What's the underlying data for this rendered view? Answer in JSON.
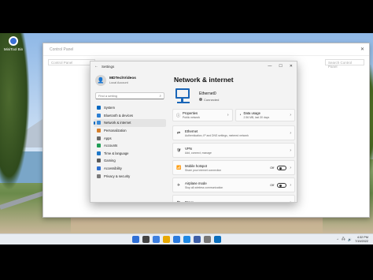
{
  "desktop": {
    "icon_label": "MiniTool Bin"
  },
  "control_panel": {
    "title": "Control Panel",
    "address": "Control Panel",
    "search": "Search Control Panel",
    "close": "✕"
  },
  "settings": {
    "window_title": "Settings",
    "back": "←",
    "controls": {
      "minimize": "—",
      "maximize": "☐",
      "close": "✕"
    },
    "user": {
      "name": "MDTechVideos",
      "account": "Local Account"
    },
    "search_placeholder": "Find a setting",
    "nav": [
      {
        "label": "System",
        "color": "#0067c0",
        "active": false
      },
      {
        "label": "Bluetooth & devices",
        "color": "#2d7fd3",
        "active": false
      },
      {
        "label": "Network & internet",
        "color": "#3a8ad6",
        "active": true
      },
      {
        "label": "Personalization",
        "color": "#d67f2a",
        "active": false
      },
      {
        "label": "Apps",
        "color": "#6b6b6b",
        "active": false
      },
      {
        "label": "Accounts",
        "color": "#1f9d55",
        "active": false
      },
      {
        "label": "Time & language",
        "color": "#1f78c8",
        "active": false
      },
      {
        "label": "Gaming",
        "color": "#5b5b5b",
        "active": false
      },
      {
        "label": "Accessibility",
        "color": "#2d6fd0",
        "active": false
      },
      {
        "label": "Privacy & security",
        "color": "#7a7a7a",
        "active": false
      }
    ],
    "page_title": "Network & internet",
    "hero": {
      "name": "Ethernet0",
      "status": "Connected"
    },
    "properties": {
      "title": "Properties",
      "subtitle": "Public network"
    },
    "data_usage": {
      "title": "Data usage",
      "subtitle": "2.56 MB, last 30 days"
    },
    "cards": [
      {
        "icon": "⇄",
        "title": "Ethernet",
        "subtitle": "Authentication, IP and DNS settings, metered network",
        "toggle": false,
        "state": ""
      },
      {
        "icon": "🛡",
        "title": "VPN",
        "subtitle": "Add, connect, manage",
        "toggle": false,
        "state": ""
      },
      {
        "icon": "📶",
        "title": "Mobile hotspot",
        "subtitle": "Share your internet connection",
        "toggle": true,
        "state": "Off"
      },
      {
        "icon": "✈",
        "title": "Airplane mode",
        "subtitle": "Stop all wireless communication",
        "toggle": true,
        "state": "Off"
      },
      {
        "icon": "⇆",
        "title": "Proxy",
        "subtitle": "",
        "toggle": false,
        "state": ""
      }
    ]
  },
  "taskbar": {
    "icons": [
      "#2f6fd6",
      "#444",
      "#3d7fe0",
      "#e8a800",
      "#2a7adf",
      "#1e88e5",
      "#3d5fa8",
      "#777",
      "#0a6ebd"
    ],
    "time": "4:32 PM",
    "date": "7/19/2022"
  }
}
